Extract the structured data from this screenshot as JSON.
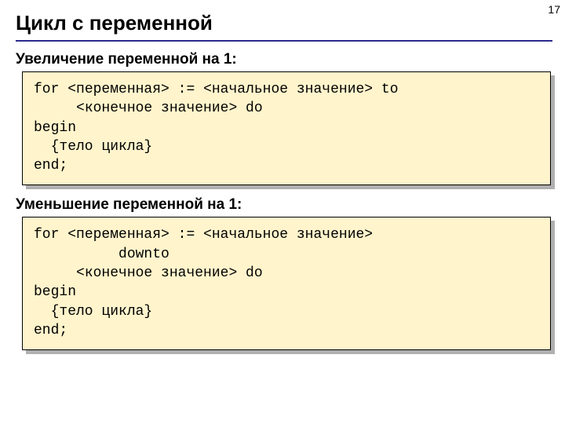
{
  "page_number": "17",
  "title": "Цикл с переменной",
  "section1": {
    "heading": "Увеличение переменной на 1:",
    "code": {
      "l1a": "for ",
      "l1b": "<переменная>",
      "l1c": " := ",
      "l1d": "<начальное значение>",
      "l1e": " to",
      "l2a": "     ",
      "l2b": "<конечное значение>",
      "l2c": " do",
      "l3": "begin",
      "l4": "  {тело цикла}",
      "l5": "end;"
    }
  },
  "section2": {
    "heading": "Уменьшение переменной на 1:",
    "code": {
      "l1a": "for ",
      "l1b": "<переменная>",
      "l1c": " := ",
      "l1d": "<начальное значение>",
      "l2": "          downto",
      "l3a": "     ",
      "l3b": "<конечное значение>",
      "l3c": " do",
      "l4": "begin",
      "l5": "  {тело цикла}",
      "l6": "end;"
    }
  }
}
